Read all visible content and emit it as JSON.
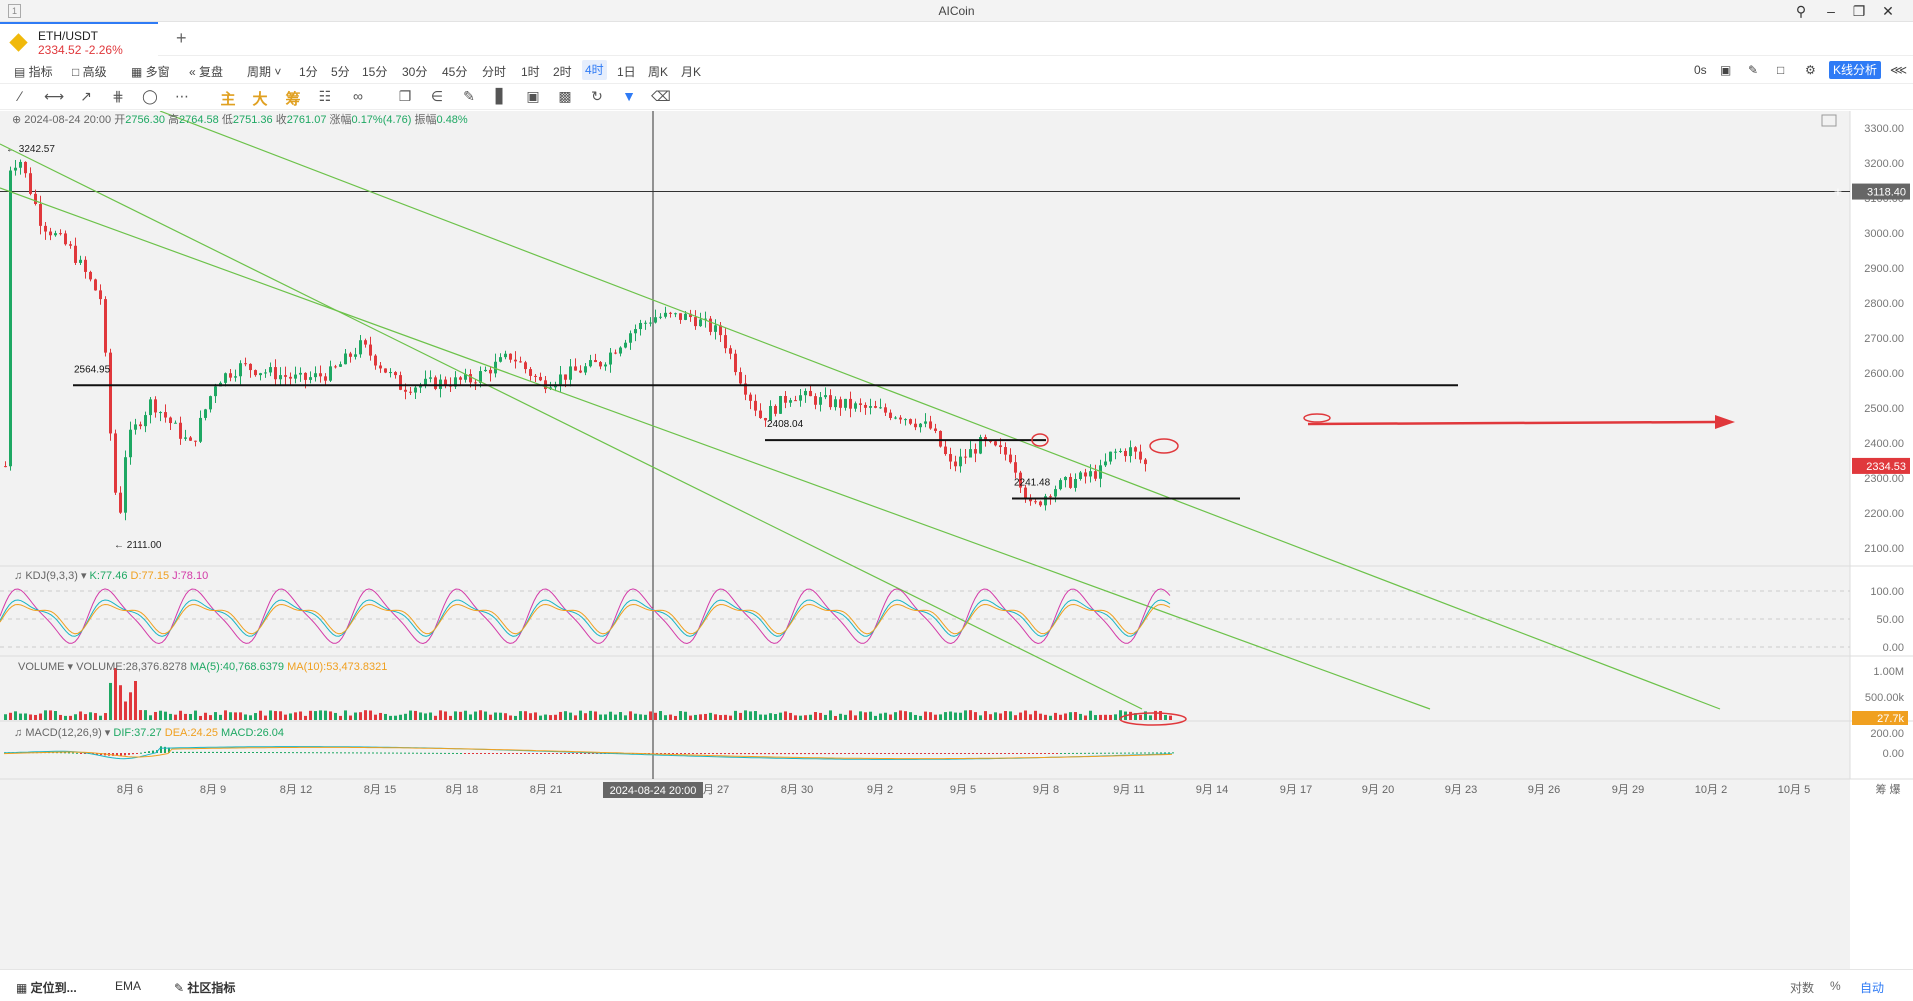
{
  "window": {
    "title": "AICoin"
  },
  "tab": {
    "symbol": "ETH/USDT",
    "price": "2334.52",
    "change": "-2.26%"
  },
  "menu": {
    "items": [
      "指标",
      "高级",
      "多窗",
      "复盘",
      "周期"
    ],
    "periods": [
      "1分",
      "5分",
      "15分",
      "30分",
      "45分",
      "分时",
      "1时",
      "2时",
      "4时",
      "1日",
      "周K",
      "月K"
    ],
    "active_period": "4时",
    "delay": "0s",
    "kline_button": "K线分析"
  },
  "toolbar": {
    "main": "主",
    "big": "大",
    "chip": "筹"
  },
  "ohlc": {
    "datetime": "2024-08-24 20:00",
    "open_label": "开",
    "open": "2756.30",
    "high_label": "高",
    "high": "2764.58",
    "low_label": "低",
    "low": "2751.36",
    "close_label": "收",
    "close": "2761.07",
    "change_label": "涨幅",
    "change": "0.17%(4.76)",
    "amp_label": "振幅",
    "amp": "0.48%"
  },
  "price_axis": [
    "3300.00",
    "3200.00",
    "3100.00",
    "3000.00",
    "2900.00",
    "2800.00",
    "2700.00",
    "2600.00",
    "2500.00",
    "2400.00",
    "2300.00",
    "2200.00",
    "2100.00"
  ],
  "price_markers": {
    "crosshair": "3118.40",
    "last": "2334.53",
    "high": "3242.57",
    "low": "2111.00"
  },
  "annotations": {
    "level1": "2564.95",
    "level2": "2408.04",
    "level3": "2241.48"
  },
  "kdj": {
    "name": "KDJ(9,3,3)",
    "k": "K:77.46",
    "d": "D:77.15",
    "j": "J:78.10",
    "axis": [
      "100.00",
      "50.00",
      "0.00"
    ]
  },
  "volume": {
    "name": "VOLUME",
    "value": "VOLUME:28,376.8278",
    "ma5": "MA(5):40,768.6379",
    "ma10": "MA(10):53,473.8321",
    "axis": [
      "1.00M",
      "500.00k"
    ],
    "last": "27.7k"
  },
  "macd": {
    "name": "MACD(12,26,9)",
    "dif": "DIF:37.27",
    "dea": "DEA:24.25",
    "macd": "MACD:26.04",
    "axis": [
      "200.00",
      "0.00"
    ]
  },
  "time_axis": [
    "8月 6",
    "8月 9",
    "8月 12",
    "8月 15",
    "8月 18",
    "8月 21",
    "8月 27",
    "8月 30",
    "9月 2",
    "9月 5",
    "9月 8",
    "9月 11",
    "9月 14",
    "9月 17",
    "9月 20",
    "9月 23",
    "9月 26",
    "9月 29",
    "10月 2",
    "10月 5"
  ],
  "time_crosshair": "2024-08-24 20:00",
  "axis_corner": "筹 爆",
  "bottom": {
    "locate": "定位到...",
    "ema": "EMA",
    "community": "社区指标",
    "log": "对数",
    "percent": "%",
    "auto": "自动"
  },
  "colors": {
    "up": "#1ea863",
    "down": "#e0383c",
    "trend": "#6cc24a",
    "accent": "#2f7bf5",
    "k": "#f0a020",
    "d": "#19b5c4",
    "j": "#d33aa8"
  }
}
